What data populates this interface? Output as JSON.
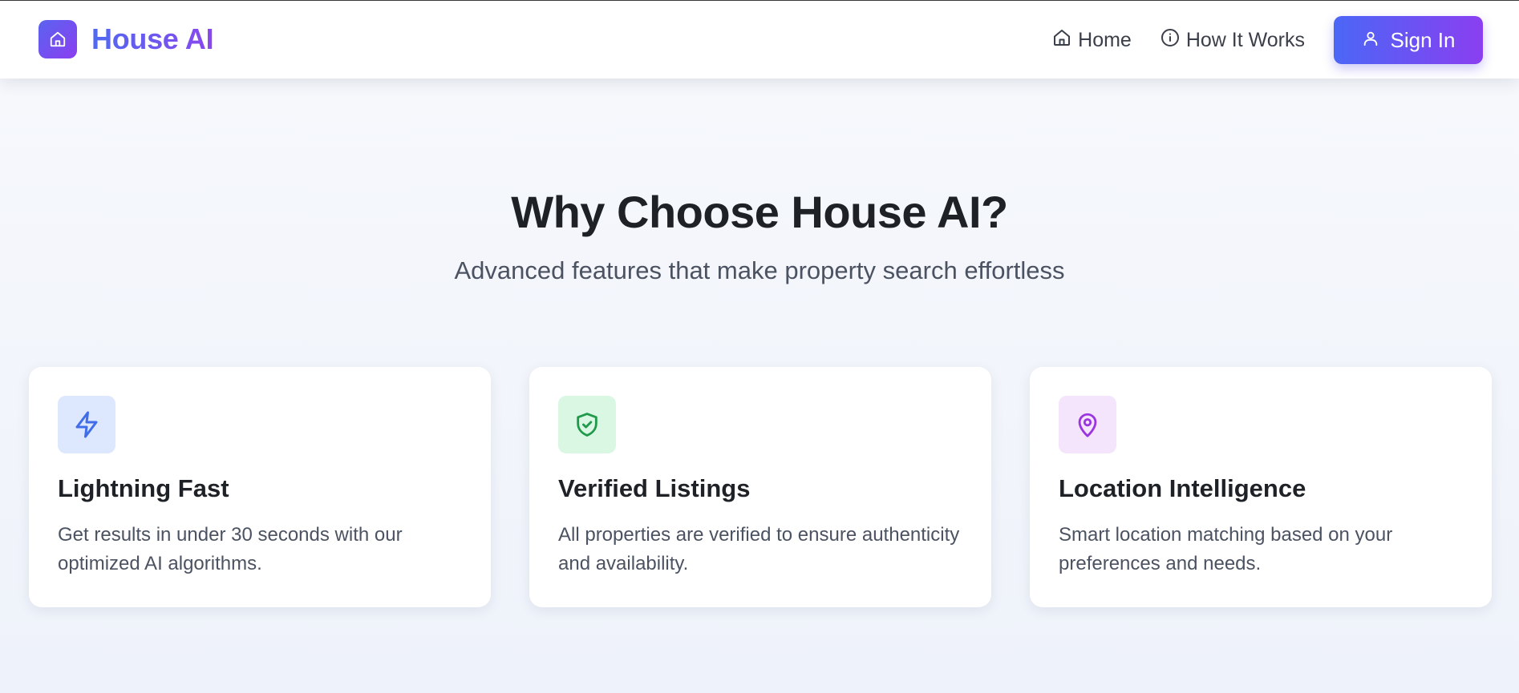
{
  "header": {
    "brand_name": "House AI",
    "nav": {
      "home_label": "Home",
      "how_label": "How It Works",
      "signin_label": "Sign In"
    }
  },
  "features": {
    "title": "Why Choose House AI?",
    "subtitle": "Advanced features that make property search effortless",
    "cards": [
      {
        "icon": "lightning-icon",
        "icon_bg": "#dde8fe",
        "icon_color": "#3f6ee8",
        "title": "Lightning Fast",
        "description": "Get results in under 30 seconds with our optimized AI algorithms."
      },
      {
        "icon": "shield-check-icon",
        "icon_bg": "#daf7e3",
        "icon_color": "#1f9a4a",
        "title": "Verified Listings",
        "description": "All properties are verified to ensure authenticity and availability."
      },
      {
        "icon": "map-pin-icon",
        "icon_bg": "#f4e5fd",
        "icon_color": "#9b35e0",
        "title": "Location Intelligence",
        "description": "Smart location matching based on your preferences and needs."
      }
    ]
  },
  "colors": {
    "brand_gradient_start": "#4f6af0",
    "brand_gradient_end": "#8a47ee",
    "page_background": "#f4f7fc"
  }
}
